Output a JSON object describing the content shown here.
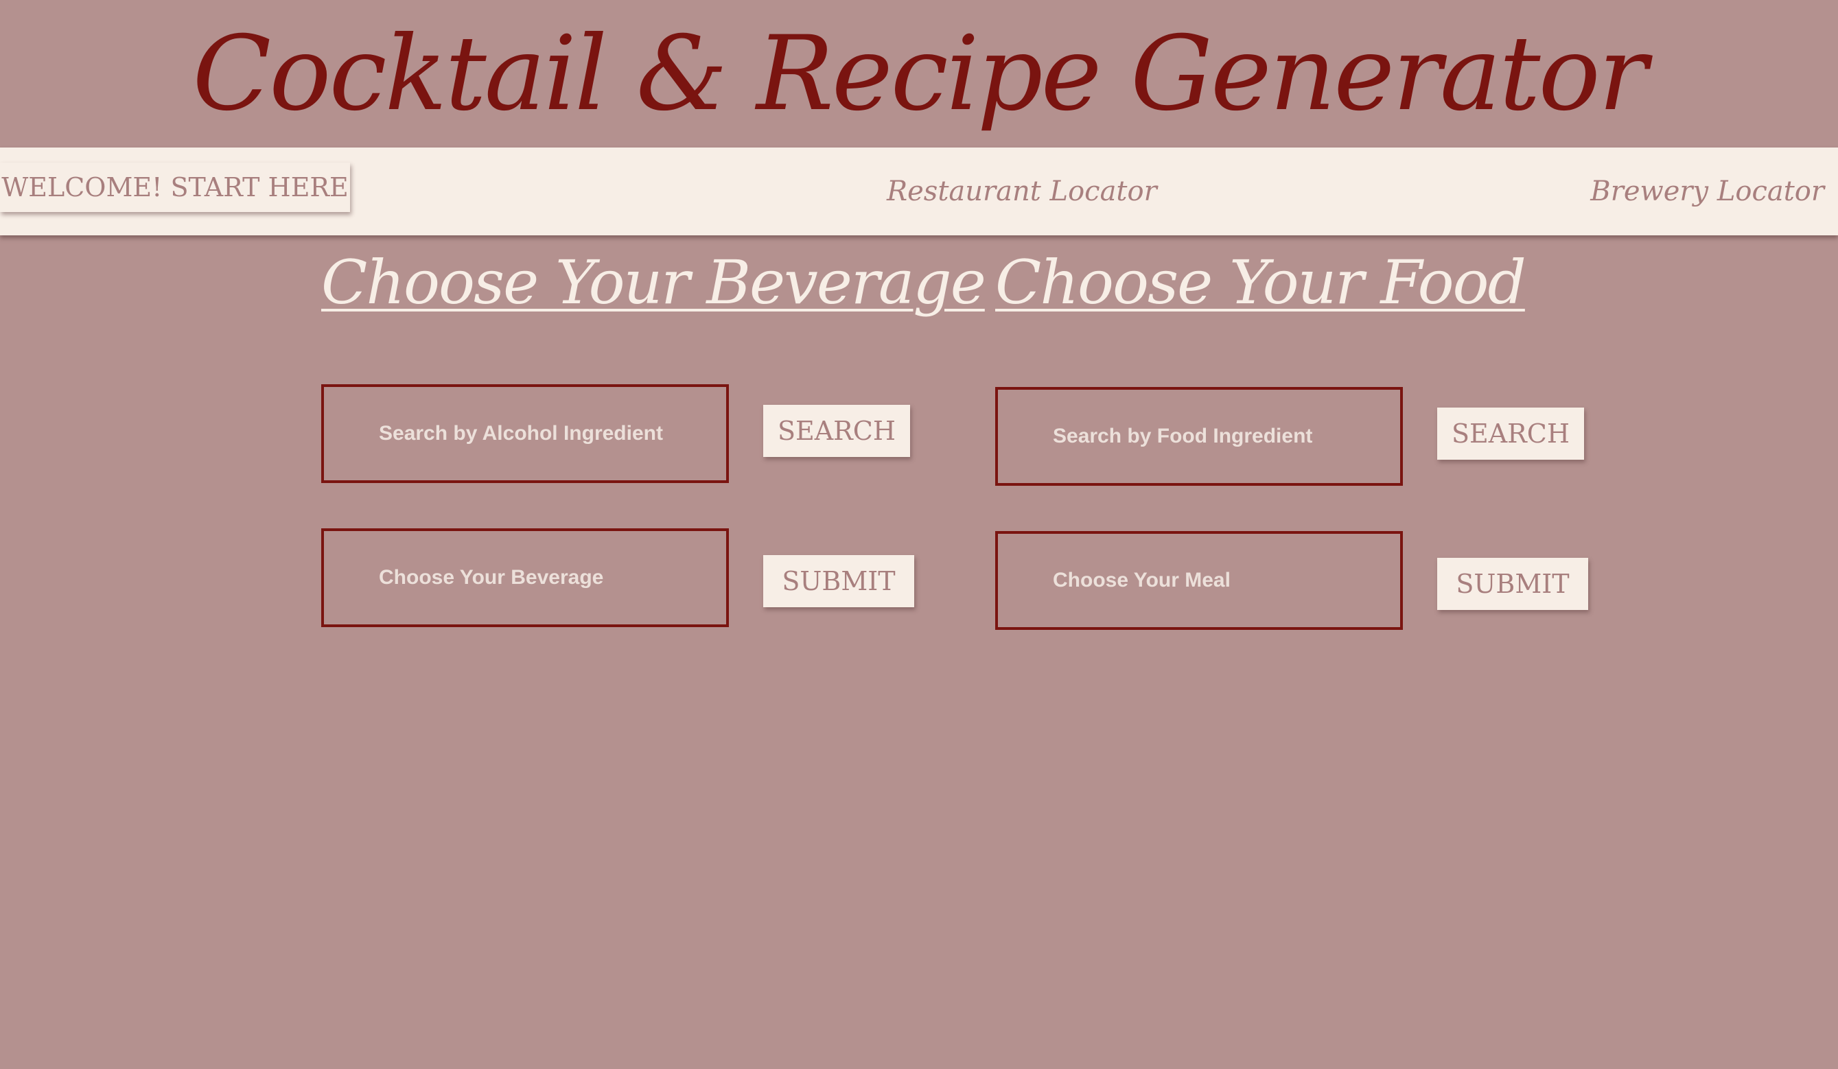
{
  "header": {
    "title": "Cocktail & Recipe Generator"
  },
  "nav": {
    "welcome_label": "WELCOME! START HERE",
    "restaurant_locator": "Restaurant Locator",
    "brewery_locator": "Brewery Locator"
  },
  "beverage": {
    "heading": "Choose Your Beverage",
    "search_placeholder": "Search by Alcohol Ingredient",
    "search_button": "SEARCH",
    "choose_placeholder": "Choose Your Beverage",
    "submit_button": "SUBMIT"
  },
  "food": {
    "heading": "Choose Your Food",
    "search_placeholder": "Search by Food Ingredient",
    "search_button": "SEARCH",
    "choose_placeholder": "Choose Your Meal",
    "submit_button": "SUBMIT"
  },
  "colors": {
    "background": "#b4918f",
    "title": "#7a1410",
    "navbar": "#f7eee6",
    "nav_text": "#a87f7e",
    "heading_text": "#f7eee6",
    "field_border": "#7a1410"
  }
}
